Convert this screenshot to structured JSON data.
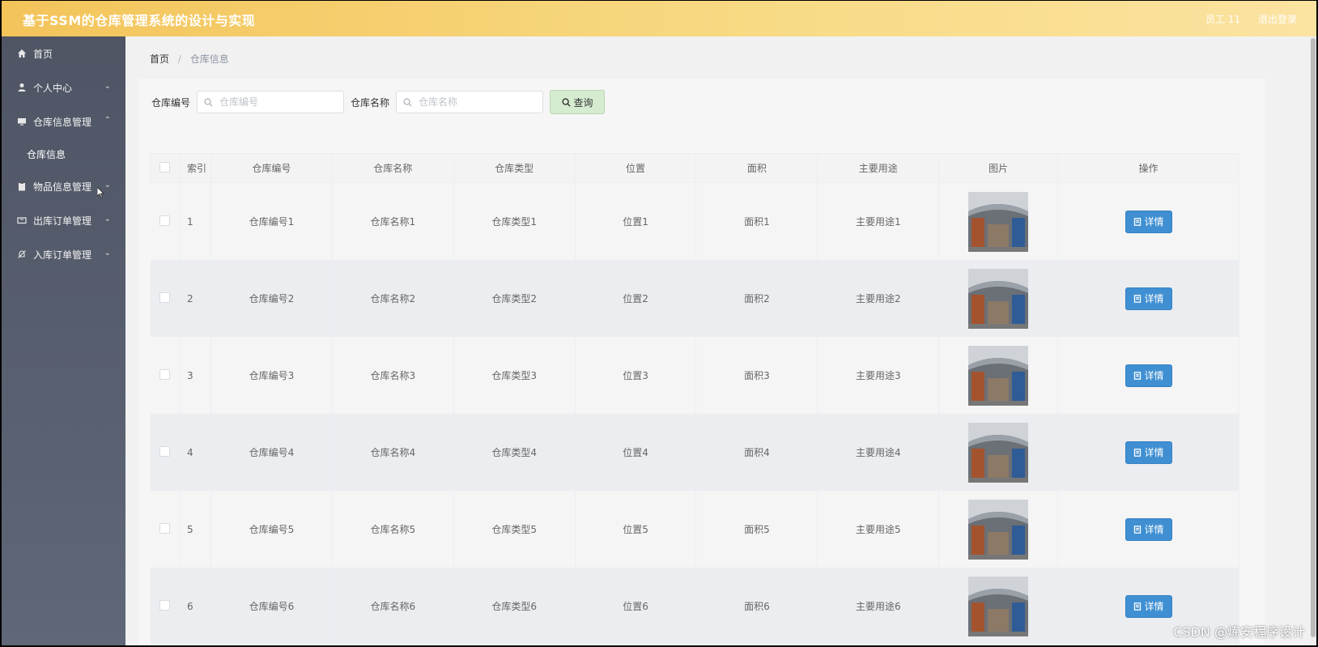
{
  "header": {
    "title": "基于SSM的仓库管理系统的设计与实现",
    "user": "员工 11",
    "logout": "退出登录"
  },
  "sidebar": {
    "items": [
      {
        "label": "首页",
        "icon": "home-icon"
      },
      {
        "label": "个人中心",
        "icon": "user-icon"
      },
      {
        "label": "仓库信息管理",
        "icon": "monitor-icon"
      },
      {
        "label": "物品信息管理",
        "icon": "clipboard-icon"
      },
      {
        "label": "出库订单管理",
        "icon": "ticket-icon"
      },
      {
        "label": "入库订单管理",
        "icon": "bell-off-icon"
      }
    ],
    "sub_item": "仓库信息"
  },
  "breadcrumb": {
    "home": "首页",
    "separator": "/",
    "current": "仓库信息"
  },
  "search": {
    "code_label": "仓库编号",
    "code_placeholder": "仓库编号",
    "name_label": "仓库名称",
    "name_placeholder": "仓库名称",
    "query_label": "查询"
  },
  "table": {
    "headers": [
      "索引",
      "仓库编号",
      "仓库名称",
      "仓库类型",
      "位置",
      "面积",
      "主要用途",
      "图片",
      "操作"
    ],
    "rows": [
      {
        "index": "1",
        "code": "仓库编号1",
        "name": "仓库名称1",
        "type": "仓库类型1",
        "location": "位置1",
        "area": "面积1",
        "usage": "主要用途1"
      },
      {
        "index": "2",
        "code": "仓库编号2",
        "name": "仓库名称2",
        "type": "仓库类型2",
        "location": "位置2",
        "area": "面积2",
        "usage": "主要用途2"
      },
      {
        "index": "3",
        "code": "仓库编号3",
        "name": "仓库名称3",
        "type": "仓库类型3",
        "location": "位置3",
        "area": "面积3",
        "usage": "主要用途3"
      },
      {
        "index": "4",
        "code": "仓库编号4",
        "name": "仓库名称4",
        "type": "仓库类型4",
        "location": "位置4",
        "area": "面积4",
        "usage": "主要用途4"
      },
      {
        "index": "5",
        "code": "仓库编号5",
        "name": "仓库名称5",
        "type": "仓库类型5",
        "location": "位置5",
        "area": "面积5",
        "usage": "主要用途5"
      },
      {
        "index": "6",
        "code": "仓库编号6",
        "name": "仓库名称6",
        "type": "仓库类型6",
        "location": "位置6",
        "area": "面积6",
        "usage": "主要用途6"
      }
    ],
    "detail_label": "详情"
  },
  "watermark": "CSDN @炼安程序设计",
  "colors": {
    "topbar": "#f3c45a",
    "sidebar": "#545b6b",
    "primary": "#3f8fd2",
    "query_bg": "#d6ecd0"
  }
}
